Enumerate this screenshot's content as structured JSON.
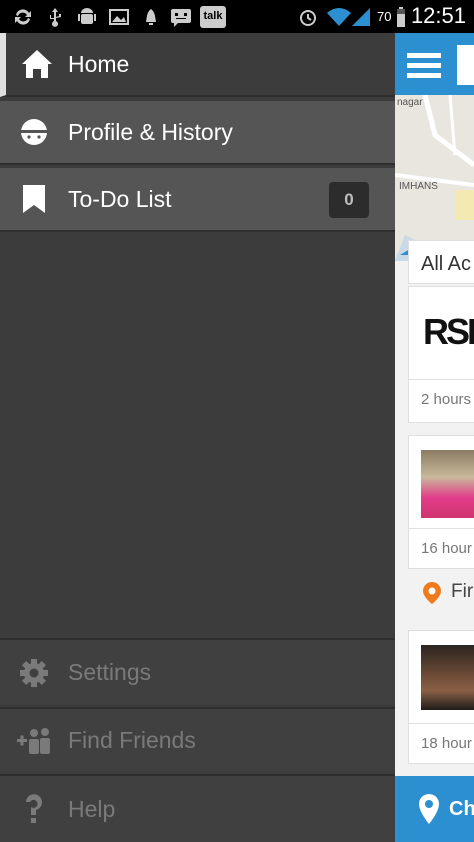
{
  "status_bar": {
    "battery": "70",
    "time": "12:51",
    "talk_label": "talk"
  },
  "drawer": {
    "items": [
      {
        "label": "Home"
      },
      {
        "label": "Profile & History"
      },
      {
        "label": "To-Do List",
        "badge": "0"
      }
    ],
    "bottom_items": [
      {
        "label": "Settings"
      },
      {
        "label": "Find Friends"
      },
      {
        "label": "Help"
      }
    ]
  },
  "content": {
    "map_labels": [
      "nagar",
      "IMHANS"
    ],
    "feed_header": "All Ac",
    "logo_text": "RSK",
    "times": [
      "2 hours",
      "16 hour",
      "18 hour"
    ],
    "find_text": "Fir",
    "checkin": "Che"
  },
  "colors": {
    "accent": "#2c8fd0",
    "drawer_bg": "#3c3c3c",
    "orange": "#f07a1e"
  }
}
